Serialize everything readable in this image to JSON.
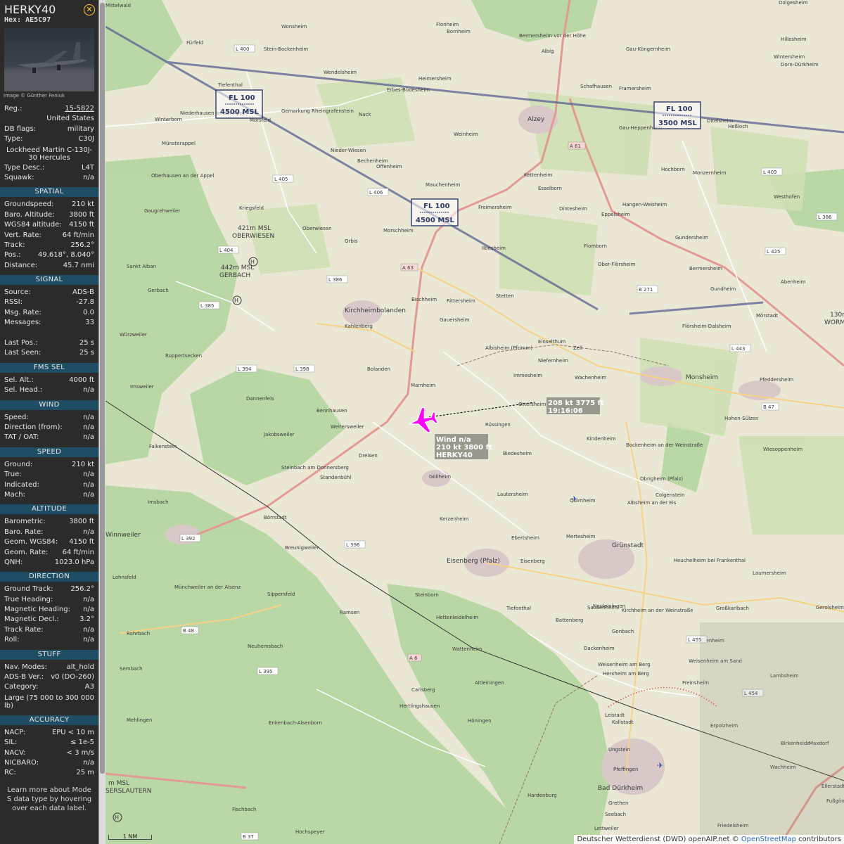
{
  "aircraft": {
    "callsign": "HERKY40",
    "hex": "Hex: AE5C97",
    "image_credit": "Image © Günther Feniuk"
  },
  "details": [
    {
      "k": "Reg.:",
      "v": "15-5822",
      "link": true
    },
    {
      "k": "",
      "v": "United States"
    },
    {
      "k": "DB flags:",
      "v": "military"
    },
    {
      "k": "Type:",
      "v": "C30J"
    },
    {
      "k": "",
      "v": "Lockheed Martin C-130J-30 Hercules",
      "tall": true
    },
    {
      "k": "Type Desc.:",
      "v": "L4T"
    },
    {
      "k": "Squawk:",
      "v": "n/a"
    }
  ],
  "sections": [
    {
      "title": "SPATIAL",
      "rows": [
        {
          "k": "Groundspeed:",
          "v": "210 kt"
        },
        {
          "k": "Baro. Altitude:",
          "v": "3800 ft"
        },
        {
          "k": "WGS84 altitude:",
          "v": "4150 ft"
        },
        {
          "k": "Vert. Rate:",
          "v": "64 ft/min"
        },
        {
          "k": "Track:",
          "v": "256.2°"
        },
        {
          "k": "Pos.:",
          "v": "49.618°, 8.040°"
        },
        {
          "k": "Distance:",
          "v": "45.7 nmi"
        }
      ]
    },
    {
      "title": "SIGNAL",
      "rows": [
        {
          "k": "Source:",
          "v": "ADS-B"
        },
        {
          "k": "RSSI:",
          "v": "-27.8"
        },
        {
          "k": "Msg. Rate:",
          "v": "0.0"
        },
        {
          "k": "Messages:",
          "v": "33"
        },
        {
          "k": "",
          "v": ""
        },
        {
          "k": "Last Pos.:",
          "v": "25 s"
        },
        {
          "k": "Last Seen:",
          "v": "25 s"
        }
      ]
    },
    {
      "title": "FMS SEL",
      "rows": [
        {
          "k": "Sel. Alt.:",
          "v": "4000 ft"
        },
        {
          "k": "Sel. Head.:",
          "v": "n/a"
        }
      ]
    },
    {
      "title": "WIND",
      "rows": [
        {
          "k": "Speed:",
          "v": "n/a"
        },
        {
          "k": "Direction (from):",
          "v": "n/a"
        },
        {
          "k": "TAT / OAT:",
          "v": "n/a"
        }
      ]
    },
    {
      "title": "SPEED",
      "rows": [
        {
          "k": "Ground:",
          "v": "210 kt"
        },
        {
          "k": "True:",
          "v": "n/a"
        },
        {
          "k": "Indicated:",
          "v": "n/a"
        },
        {
          "k": "Mach:",
          "v": "n/a"
        }
      ]
    },
    {
      "title": "ALTITUDE",
      "rows": [
        {
          "k": "Barometric:",
          "v": "3800 ft"
        },
        {
          "k": "Baro. Rate:",
          "v": "n/a"
        },
        {
          "k": "Geom. WGS84:",
          "v": "4150 ft"
        },
        {
          "k": "Geom. Rate:",
          "v": "64 ft/min"
        },
        {
          "k": "QNH:",
          "v": "1023.0 hPa"
        }
      ]
    },
    {
      "title": "DIRECTION",
      "rows": [
        {
          "k": "Ground Track:",
          "v": "256.2°"
        },
        {
          "k": "True Heading:",
          "v": "n/a"
        },
        {
          "k": "Magnetic Heading:",
          "v": "n/a"
        },
        {
          "k": "Magnetic Decl.:",
          "v": "3.2°"
        },
        {
          "k": "Track Rate:",
          "v": "n/a"
        },
        {
          "k": "Roll:",
          "v": "n/a"
        }
      ]
    },
    {
      "title": "STUFF",
      "rows": [
        {
          "k": "Nav. Modes:",
          "v": "alt_hold"
        },
        {
          "k": "ADS-B Ver.:",
          "v": "v0 (DO-260)"
        },
        {
          "k": "Category:",
          "v": "A3"
        },
        {
          "k": "Large (75 000 to 300 000 lb)",
          "v": "",
          "tall": true
        }
      ]
    },
    {
      "title": "ACCURACY",
      "rows": [
        {
          "k": "NACP:",
          "v": "EPU < 10 m"
        },
        {
          "k": "SIL:",
          "v": "≤ 1e-5"
        },
        {
          "k": "NACV:",
          "v": "< 3 m/s"
        },
        {
          "k": "NICBARO:",
          "v": "n/a"
        },
        {
          "k": "RC:",
          "v": "25 m"
        }
      ]
    }
  ],
  "learn_more": "Learn more about Mode S data type by hovering over each data label.",
  "map": {
    "airspace": [
      {
        "top": "FL 100",
        "bottom": "4500 MSL"
      },
      {
        "top": "FL 100",
        "bottom": "3500 MSL"
      },
      {
        "top": "FL 100",
        "bottom": "4500 MSL"
      }
    ],
    "aircraft_label": [
      "Wind n/a",
      "210 kt  3800 ft",
      "HERKY40"
    ],
    "track_label": [
      "208 kt  3775 ft",
      "19:16:06"
    ],
    "elevations": [
      "421m MSL",
      "OBERWIESEN",
      "442m MSL",
      "GERBACH",
      "130m",
      "WORMS",
      "m MSL",
      "SERSLAUTERN"
    ],
    "towns": [
      {
        "name": "Wonsheim"
      },
      {
        "name": "Flonheim"
      },
      {
        "name": "Bornheim"
      },
      {
        "name": "Bermersheim vor der Höhe"
      },
      {
        "name": "Albig"
      },
      {
        "name": "Gau-Köngernheim"
      },
      {
        "name": "Hillesheim"
      },
      {
        "name": "Dolgesheim"
      },
      {
        "name": "Wintersheim"
      },
      {
        "name": "Dorn-Dürkheim"
      },
      {
        "name": "Fürfeld"
      },
      {
        "name": "Stein-Bockenheim"
      },
      {
        "name": "Wendelsheim"
      },
      {
        "name": "Heimersheim"
      },
      {
        "name": "Erbes-Büdesheim"
      },
      {
        "name": "Schafhausen"
      },
      {
        "name": "Framersheim"
      },
      {
        "name": "Tiefenthal"
      },
      {
        "name": "Alzey"
      },
      {
        "name": "Gau-Heppenheim"
      },
      {
        "name": "Ditelsheim"
      },
      {
        "name": "Heßloch"
      },
      {
        "name": "Niederhausen an der Appel"
      },
      {
        "name": "Mörsfeld"
      },
      {
        "name": "Nack"
      },
      {
        "name": "Winterborn"
      },
      {
        "name": "Weinheim"
      },
      {
        "name": "Münsterappel"
      },
      {
        "name": "Nieder-Wiesen"
      },
      {
        "name": "Bechenheim"
      },
      {
        "name": "Offenheim"
      },
      {
        "name": "Hochborn"
      },
      {
        "name": "Monzernheim"
      },
      {
        "name": "Westhofen"
      },
      {
        "name": "Oberhausen an der Appel"
      },
      {
        "name": "Mauchenheim"
      },
      {
        "name": "Kettenheim"
      },
      {
        "name": "Esselborn"
      },
      {
        "name": "Hangen-Weisheim"
      },
      {
        "name": "Kriegsfeld"
      },
      {
        "name": "Freimersheim"
      },
      {
        "name": "Dintesheim"
      },
      {
        "name": "Eppelsheim"
      },
      {
        "name": "Gaugrehweiler"
      },
      {
        "name": "Oberwiesen"
      },
      {
        "name": "Morschheim"
      },
      {
        "name": "Gundersheim"
      },
      {
        "name": "Orbis"
      },
      {
        "name": "Ilbesheim"
      },
      {
        "name": "Flomborn"
      },
      {
        "name": "Bermersheim"
      },
      {
        "name": "Ober-Flörsheim"
      },
      {
        "name": "Sankt Alban"
      },
      {
        "name": "Gundheim"
      },
      {
        "name": "Abenheim"
      },
      {
        "name": "Gerbach"
      },
      {
        "name": "Bischheim"
      },
      {
        "name": "Rittersheim"
      },
      {
        "name": "Stetten"
      },
      {
        "name": "Kirchheimbolanden"
      },
      {
        "name": "Gauersheim"
      },
      {
        "name": "Flörsheim-Dalsheim"
      },
      {
        "name": "Mörstadt"
      },
      {
        "name": "Kahlenberg"
      },
      {
        "name": "Würzweiler"
      },
      {
        "name": "Einselthum"
      },
      {
        "name": "Albisheim (Pfrimm)"
      },
      {
        "name": "Zell"
      },
      {
        "name": "Ruppertsecken"
      },
      {
        "name": "Niefernheim"
      },
      {
        "name": "Bolanden"
      },
      {
        "name": "Immesheim"
      },
      {
        "name": "Wachenheim"
      },
      {
        "name": "Monsheim"
      },
      {
        "name": "Pfeddersheim"
      },
      {
        "name": "Marnheim"
      },
      {
        "name": "Imsweiler"
      },
      {
        "name": "Dannenfels"
      },
      {
        "name": "Ottersheim"
      },
      {
        "name": "Rüssingen"
      },
      {
        "name": "Bennhausen"
      },
      {
        "name": "Hohen-Sülzen"
      },
      {
        "name": "Weitersweiler"
      },
      {
        "name": "Falkenstein"
      },
      {
        "name": "Jakobsweiler"
      },
      {
        "name": "Kindenheim"
      },
      {
        "name": "Bockenheim an der Weinstraße"
      },
      {
        "name": "Wiesoppenheim"
      },
      {
        "name": "Dreisen"
      },
      {
        "name": "Biedesheim"
      },
      {
        "name": "Steinbach am Donnersberg"
      },
      {
        "name": "Standenbühl"
      },
      {
        "name": "Göllheim"
      },
      {
        "name": "Obrigheim (Pfalz)"
      },
      {
        "name": "Lautersheim"
      },
      {
        "name": "Quirnheim"
      },
      {
        "name": "Colgenstein"
      },
      {
        "name": "Imsbach"
      },
      {
        "name": "Albsheim an der Eis"
      },
      {
        "name": "Kerzenheim"
      },
      {
        "name": "Börrstadt"
      },
      {
        "name": "Großniedesheim"
      },
      {
        "name": "Winnweiler"
      },
      {
        "name": "Ebertsheim"
      },
      {
        "name": "Mertesheim"
      },
      {
        "name": "Grünstadt"
      },
      {
        "name": "Heuchelheim bei Frankenthal"
      },
      {
        "name": "Breunigweiler"
      },
      {
        "name": "Eisenberg (Pfalz)"
      },
      {
        "name": "Lohnsfeld"
      },
      {
        "name": "Laumersheim"
      },
      {
        "name": "Münchweiler an der Alsenz"
      },
      {
        "name": "Sippersfeld"
      },
      {
        "name": "Steinborn"
      },
      {
        "name": "Sausenheim"
      },
      {
        "name": "Gerolsheim"
      },
      {
        "name": "Neuleiningen"
      },
      {
        "name": "Tiefenthal"
      },
      {
        "name": "Ramsen"
      },
      {
        "name": "Kirchheim an der Weinstraße"
      },
      {
        "name": "Hettenleidelheim"
      },
      {
        "name": "Großkarlbach"
      },
      {
        "name": "Battenberg"
      },
      {
        "name": "Gonbach"
      },
      {
        "name": "Rohrbach"
      },
      {
        "name": "Neuhemsbach"
      },
      {
        "name": "Bobenheim"
      },
      {
        "name": "Wattenheim"
      },
      {
        "name": "Dackenheim"
      },
      {
        "name": "Weisenheim am Sand"
      },
      {
        "name": "Sembach"
      },
      {
        "name": "Weisenheim am Berg"
      },
      {
        "name": "Herxheim am Berg"
      },
      {
        "name": "Freinsheim"
      },
      {
        "name": "Lambsheim"
      },
      {
        "name": "Altleiningen"
      },
      {
        "name": "Carlsberg"
      },
      {
        "name": "Hertlingshausen"
      },
      {
        "name": "Mehlingen"
      },
      {
        "name": "Höningen"
      },
      {
        "name": "Leistadt"
      },
      {
        "name": "Kallstadt"
      },
      {
        "name": "Erpolzheim"
      },
      {
        "name": "Birkenheide"
      },
      {
        "name": "Maxdorf"
      },
      {
        "name": "Enkenbach-Alsenborn"
      },
      {
        "name": "Ungstein"
      },
      {
        "name": "Pfeffingen"
      },
      {
        "name": "Bad Dürkheim"
      },
      {
        "name": "Ellerstadt"
      },
      {
        "name": "Hardenburg"
      },
      {
        "name": "Grethen"
      },
      {
        "name": "Fußgönheim"
      },
      {
        "name": "Seebach"
      },
      {
        "name": "Fischbach"
      },
      {
        "name": "Hochspeyer"
      },
      {
        "name": "Friedelsheim"
      },
      {
        "name": "Gemarkung Rheingrafenstein"
      },
      {
        "name": "Mittelwald"
      },
      {
        "name": "Wachheim"
      },
      {
        "name": "Lettweiler"
      },
      {
        "name": "Eisenberg"
      }
    ],
    "roads": [
      "L 400",
      "L 405",
      "L 406",
      "L 404",
      "L 386",
      "L 385",
      "L 398",
      "L 394",
      "A 63",
      "L 392",
      "L 396",
      "B 48",
      "A 6",
      "L 395",
      "L 443",
      "B 271",
      "L 425",
      "L 409",
      "B 47",
      "L 455",
      "L 454",
      "B 37",
      "A 61",
      "L 386"
    ],
    "scale": "1 NM",
    "attribution_plain": "Deutscher Wetterdienst (DWD) openAIP.net © ",
    "attribution_link": "OpenStreetMap",
    "attribution_tail": " contributors"
  },
  "colors": {
    "accent_section": "#1f4d63",
    "aircraft": "#ff00ff",
    "close_icon": "#ffcc33"
  }
}
